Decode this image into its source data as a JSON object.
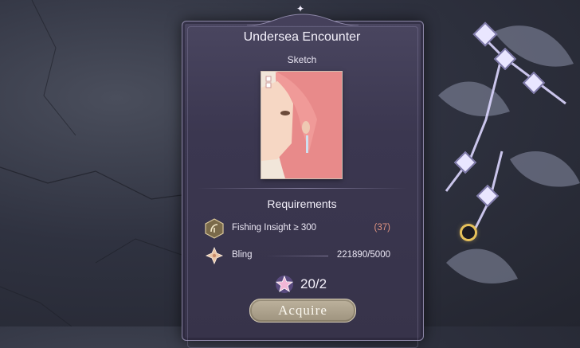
{
  "card": {
    "title": "Undersea Encounter",
    "subtitle": "Sketch"
  },
  "requirements": {
    "heading": "Requirements",
    "items": [
      {
        "label": "Fishing Insight ≥ 300",
        "value": "(37)",
        "value_color": "#e09482",
        "icon": "fishing-insight-icon"
      },
      {
        "label": "Bling",
        "value": "221890/5000",
        "value_color": "#ece8f5",
        "icon": "bling-icon"
      }
    ]
  },
  "cost": {
    "value": "20/2",
    "icon": "star-currency-icon"
  },
  "actions": {
    "acquire_label": "Acquire"
  },
  "colors": {
    "panel": "#3b3750",
    "accent": "#f4f1fb",
    "insufficient": "#e09482",
    "button": "#b0a58f"
  }
}
